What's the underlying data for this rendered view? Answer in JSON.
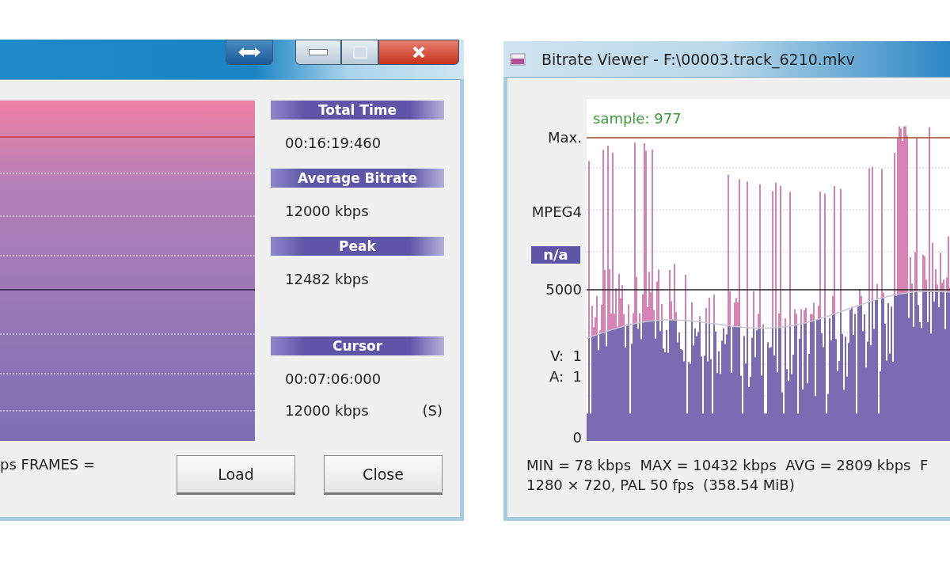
{
  "left_window": {
    "title_buttons": [
      {
        "kind": "swap"
      },
      {
        "kind": "minimize"
      },
      {
        "kind": "maximize"
      },
      {
        "kind": "close"
      }
    ],
    "stats": [
      {
        "heading": "Total Time",
        "value": "00:16:19:460"
      },
      {
        "heading": "Average Bitrate",
        "value": "12000 kbps"
      },
      {
        "heading": "Peak",
        "value": "12482 kbps"
      }
    ],
    "cursor": {
      "heading": "Cursor",
      "time": "00:07:06:000",
      "bitrate": "12000 kbps",
      "mode": "(S)"
    },
    "status_text": "ps  FRAMES =",
    "buttons": [
      "Load",
      "Close"
    ]
  },
  "right_window": {
    "title": "Bitrate Viewer - F:\\00003.track_6210.mkv",
    "sample_label": "sample: 977",
    "axis_labels": [
      {
        "kind": "max",
        "text": "Max."
      },
      {
        "kind": "codec",
        "text": "MPEG4"
      },
      {
        "kind": "badge",
        "text": "n/a"
      },
      {
        "kind": "level",
        "text": "5000"
      },
      {
        "kind": "video",
        "text": "V:  1"
      },
      {
        "kind": "audio",
        "text": "A:  1"
      },
      {
        "kind": "zero",
        "text": "0"
      }
    ],
    "summary_lines": [
      "MIN = 78 kbps  MAX = 10432 kbps  AVG = 2809 kbps  F",
      "1280 × 720, PAL 50 fps  (358.54 MiB)"
    ]
  }
}
